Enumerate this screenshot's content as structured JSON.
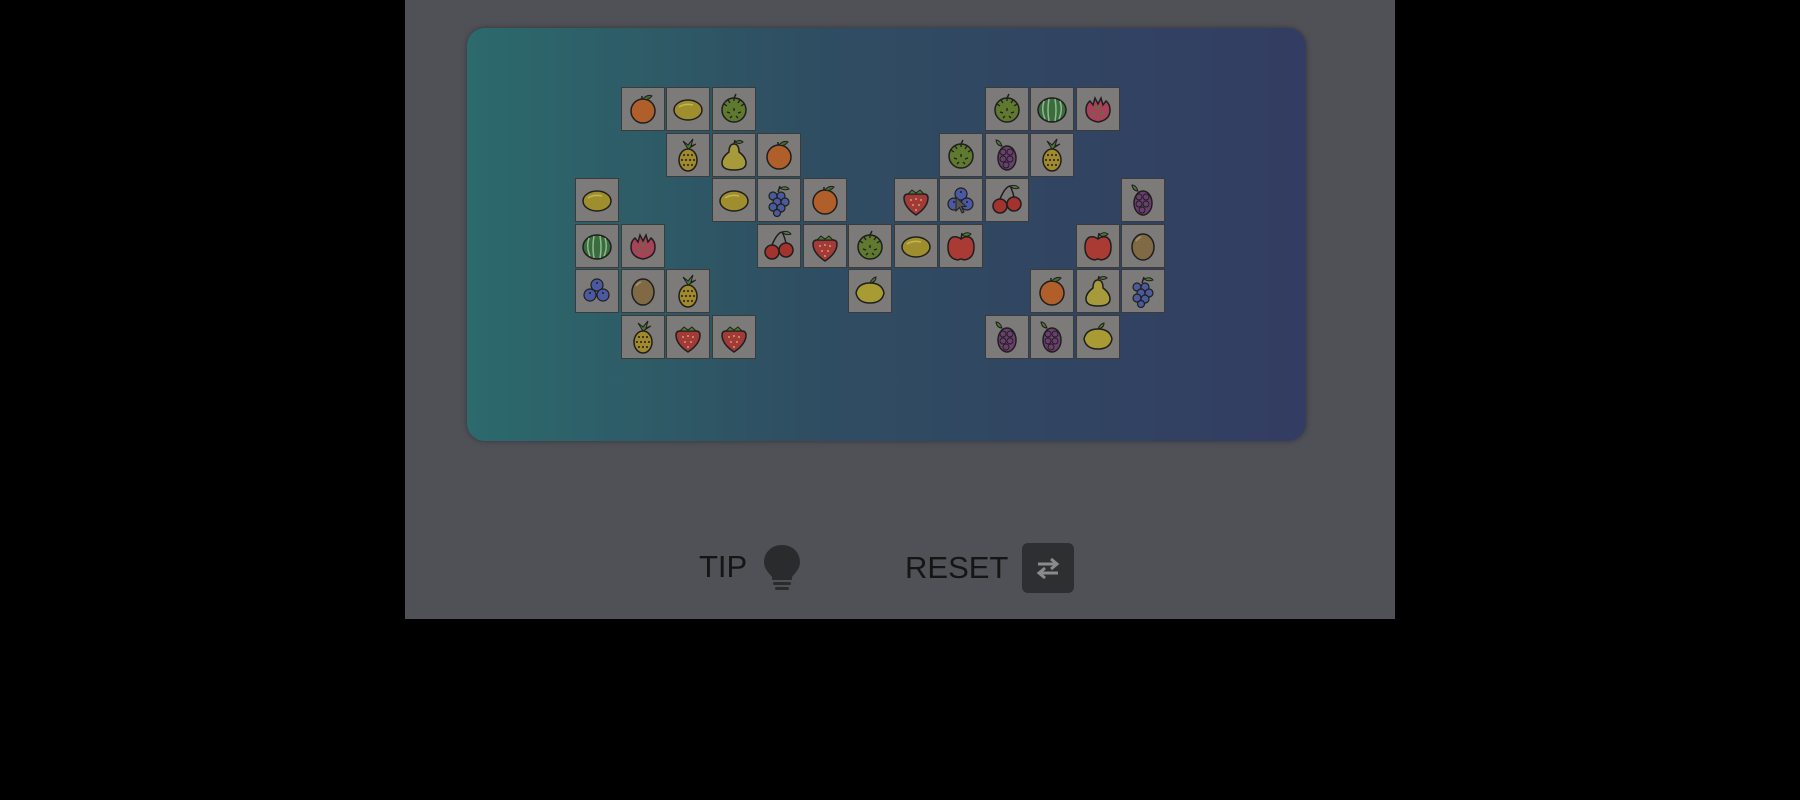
{
  "controls": {
    "tip_label": "TIP",
    "tip_icon": "lightbulb-icon",
    "reset_label": "RESET",
    "reset_icon": "swap-arrows-icon"
  },
  "board": {
    "columns": 13,
    "rows": 6,
    "tiles": [
      {
        "col": 1,
        "row": 0,
        "fruit": "orange"
      },
      {
        "col": 2,
        "row": 0,
        "fruit": "mango"
      },
      {
        "col": 3,
        "row": 0,
        "fruit": "durian"
      },
      {
        "col": 9,
        "row": 0,
        "fruit": "durian"
      },
      {
        "col": 10,
        "row": 0,
        "fruit": "watermelon"
      },
      {
        "col": 11,
        "row": 0,
        "fruit": "dragonfruit"
      },
      {
        "col": 2,
        "row": 1,
        "fruit": "pineapple"
      },
      {
        "col": 3,
        "row": 1,
        "fruit": "pear"
      },
      {
        "col": 4,
        "row": 1,
        "fruit": "orange"
      },
      {
        "col": 8,
        "row": 1,
        "fruit": "durian"
      },
      {
        "col": 9,
        "row": 1,
        "fruit": "grapes-purple"
      },
      {
        "col": 10,
        "row": 1,
        "fruit": "pineapple"
      },
      {
        "col": 0,
        "row": 2,
        "fruit": "mango"
      },
      {
        "col": 3,
        "row": 2,
        "fruit": "mango"
      },
      {
        "col": 4,
        "row": 2,
        "fruit": "grapes-blue"
      },
      {
        "col": 5,
        "row": 2,
        "fruit": "orange"
      },
      {
        "col": 7,
        "row": 2,
        "fruit": "strawberry"
      },
      {
        "col": 8,
        "row": 2,
        "fruit": "blueberries"
      },
      {
        "col": 9,
        "row": 2,
        "fruit": "cherries"
      },
      {
        "col": 12,
        "row": 2,
        "fruit": "grapes-purple"
      },
      {
        "col": 0,
        "row": 3,
        "fruit": "watermelon"
      },
      {
        "col": 1,
        "row": 3,
        "fruit": "dragonfruit"
      },
      {
        "col": 4,
        "row": 3,
        "fruit": "cherries"
      },
      {
        "col": 5,
        "row": 3,
        "fruit": "strawberry"
      },
      {
        "col": 6,
        "row": 3,
        "fruit": "durian"
      },
      {
        "col": 7,
        "row": 3,
        "fruit": "mango"
      },
      {
        "col": 8,
        "row": 3,
        "fruit": "apple"
      },
      {
        "col": 11,
        "row": 3,
        "fruit": "apple"
      },
      {
        "col": 12,
        "row": 3,
        "fruit": "kiwi"
      },
      {
        "col": 0,
        "row": 4,
        "fruit": "blueberries"
      },
      {
        "col": 1,
        "row": 4,
        "fruit": "kiwi"
      },
      {
        "col": 2,
        "row": 4,
        "fruit": "pineapple"
      },
      {
        "col": 6,
        "row": 4,
        "fruit": "lemon"
      },
      {
        "col": 10,
        "row": 4,
        "fruit": "orange"
      },
      {
        "col": 11,
        "row": 4,
        "fruit": "pear"
      },
      {
        "col": 12,
        "row": 4,
        "fruit": "grapes-blue"
      },
      {
        "col": 1,
        "row": 5,
        "fruit": "pineapple"
      },
      {
        "col": 2,
        "row": 5,
        "fruit": "strawberry"
      },
      {
        "col": 3,
        "row": 5,
        "fruit": "strawberry"
      },
      {
        "col": 9,
        "row": 5,
        "fruit": "grapes-purple"
      },
      {
        "col": 10,
        "row": 5,
        "fruit": "grapes-purple"
      },
      {
        "col": 11,
        "row": 5,
        "fruit": "lemon"
      }
    ]
  }
}
